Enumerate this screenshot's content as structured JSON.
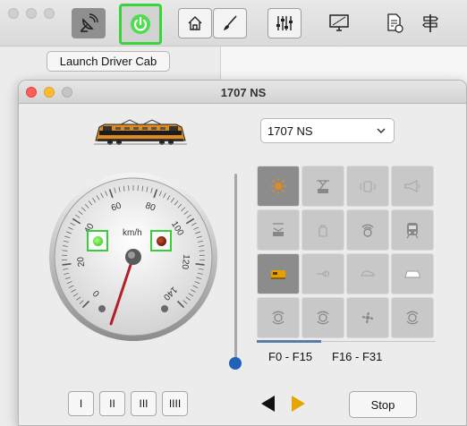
{
  "main": {
    "launch_button": "Launch Driver Cab"
  },
  "cab": {
    "window_title": "1707 NS",
    "loco_select_value": "1707 NS",
    "speed_unit": "km/h",
    "speed_ticks": [
      "0",
      "20",
      "40",
      "60",
      "80",
      "100",
      "120",
      "140"
    ],
    "speed_value": 0,
    "indicator_left_state": "on",
    "indicator_right_state": "off",
    "function_tabs": [
      "F0 - F15",
      "F16 - F31"
    ],
    "active_function_tab": "F0 - F15",
    "gear_buttons": [
      "I",
      "II",
      "III",
      "IIII"
    ],
    "stop_label": "Stop",
    "direction_forward_active": true,
    "functions": [
      {
        "icon": "light-icon",
        "active": true
      },
      {
        "icon": "pantograph-icon",
        "active": false
      },
      {
        "icon": "radio-icon",
        "active": false
      },
      {
        "icon": "horn-icon",
        "active": false
      },
      {
        "icon": "pantograph-down-icon",
        "active": false
      },
      {
        "icon": "bag-icon",
        "active": false
      },
      {
        "icon": "wifi-sound-icon",
        "active": false
      },
      {
        "icon": "train-front-icon",
        "active": false
      },
      {
        "icon": "cab-light-icon",
        "active": true
      },
      {
        "icon": "whistle-icon",
        "active": false
      },
      {
        "icon": "shunting-icon",
        "active": false
      },
      {
        "icon": "loco-icon",
        "active": false
      },
      {
        "icon": "sound1-icon",
        "active": false
      },
      {
        "icon": "sound2-icon",
        "active": false
      },
      {
        "icon": "fan-icon",
        "active": false
      },
      {
        "icon": "sound3-icon",
        "active": false
      }
    ]
  },
  "colors": {
    "accent_green": "#37cf39",
    "needle": "#b3202a",
    "slider": "#1e63b7",
    "forward_arrow": "#e6a500",
    "headlight": "#e58a1a"
  }
}
